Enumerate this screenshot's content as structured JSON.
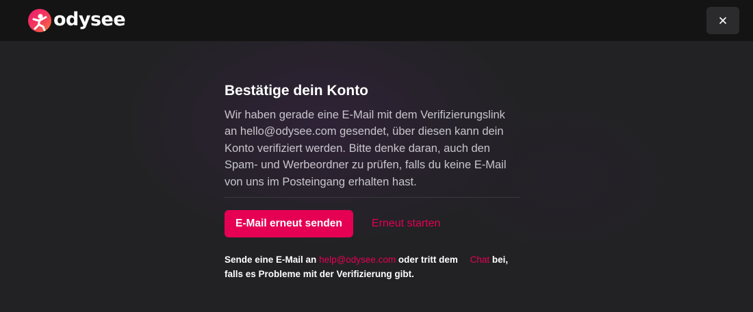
{
  "header": {
    "logo_text": "odysee",
    "close_icon": "close-icon"
  },
  "colors": {
    "accent": "#e50054",
    "header_bg": "#141414",
    "page_bg": "#222224"
  },
  "card": {
    "title": "Bestätige dein Konto",
    "body": "Wir haben gerade eine E-Mail mit dem Verifizierungslink an hello@odysee.com gesendet, über diesen kann dein Konto verifiziert werden. Bitte denke daran, auch den Spam- und Werbeordner zu prüfen, falls du keine E-Mail von uns im Posteingang erhalten hast.",
    "resend_button": "E-Mail erneut senden",
    "restart_link": "Erneut starten",
    "help": {
      "prefix": "Sende eine E-Mail an",
      "email_link": "help@odysee.com",
      "middle": "oder tritt dem",
      "chat_link": "Chat",
      "suffix": "bei, falls es Probleme mit der Verifizierung gibt."
    }
  }
}
